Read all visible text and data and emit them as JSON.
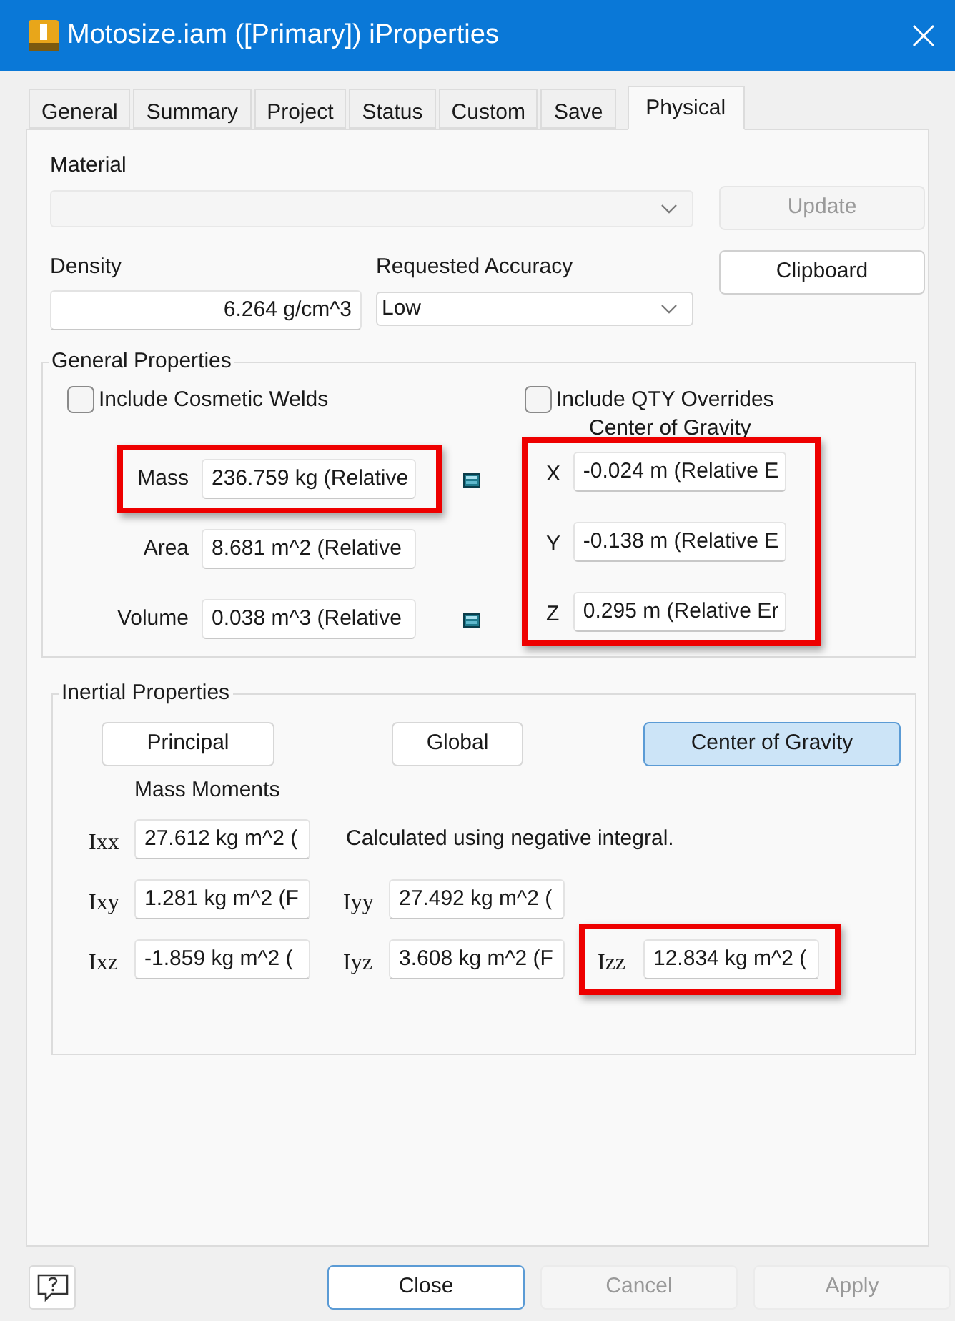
{
  "window": {
    "title": "Motosize.iam ([Primary]) iProperties"
  },
  "tabs": [
    {
      "label": "General",
      "selected": false
    },
    {
      "label": "Summary",
      "selected": false
    },
    {
      "label": "Project",
      "selected": false
    },
    {
      "label": "Status",
      "selected": false
    },
    {
      "label": "Custom",
      "selected": false
    },
    {
      "label": "Save",
      "selected": false
    },
    {
      "label": "Physical",
      "selected": true
    }
  ],
  "material": {
    "label": "Material",
    "disabled": true
  },
  "update_button": {
    "label": "Update",
    "disabled": true
  },
  "density": {
    "label": "Density",
    "value": "6.264 g/cm^3"
  },
  "requested_accuracy": {
    "label": "Requested Accuracy",
    "value": "Low"
  },
  "clipboard_button": {
    "label": "Clipboard",
    "disabled": false
  },
  "general_properties": {
    "title": "General Properties",
    "checkboxes": [
      {
        "label": "Include Cosmetic Welds",
        "checked": false
      },
      {
        "label": "Include QTY Overrides",
        "checked": false
      }
    ],
    "properties": [
      {
        "label": "Mass",
        "value": "236.759 kg (Relative",
        "highlighted": true,
        "has_icon": true
      },
      {
        "label": "Area",
        "value": "8.681 m^2 (Relative",
        "highlighted": false,
        "has_icon": false
      },
      {
        "label": "Volume",
        "value": "0.038 m^3 (Relative",
        "highlighted": false,
        "has_icon": true
      }
    ],
    "center_of_gravity": {
      "label": "Center of Gravity",
      "highlighted": true,
      "coordinates": [
        {
          "label": "X",
          "value": "-0.024 m (Relative E"
        },
        {
          "label": "Y",
          "value": "-0.138 m (Relative E"
        },
        {
          "label": "Z",
          "value": "0.295 m (Relative Er"
        }
      ]
    }
  },
  "inertial_properties": {
    "title": "Inertial Properties",
    "buttons": [
      {
        "label": "Principal",
        "selected": false
      },
      {
        "label": "Global",
        "selected": false
      },
      {
        "label": "Center of Gravity",
        "selected": true
      }
    ],
    "mass_moments_label": "Mass Moments",
    "note": "Calculated using negative integral.",
    "rows": [
      {
        "moments": [
          {
            "label": "Ixx",
            "value": "27.612 kg m^2 (",
            "highlighted": false
          }
        ]
      },
      {
        "moments": [
          {
            "label": "Ixy",
            "value": "1.281 kg m^2 (F",
            "highlighted": false
          },
          {
            "label": "Iyy",
            "value": "27.492 kg m^2 (",
            "highlighted": false
          }
        ]
      },
      {
        "moments": [
          {
            "label": "Ixz",
            "value": "-1.859 kg m^2 (",
            "highlighted": false
          },
          {
            "label": "Iyz",
            "value": "3.608 kg m^2 (F",
            "highlighted": false
          },
          {
            "label": "Izz",
            "value": "12.834 kg m^2 (",
            "highlighted": true
          }
        ]
      }
    ]
  },
  "footer": {
    "buttons": [
      {
        "label": "Close",
        "disabled": false,
        "default": true
      },
      {
        "label": "Cancel",
        "disabled": true,
        "default": false
      },
      {
        "label": "Apply",
        "disabled": true,
        "default": false
      }
    ]
  }
}
